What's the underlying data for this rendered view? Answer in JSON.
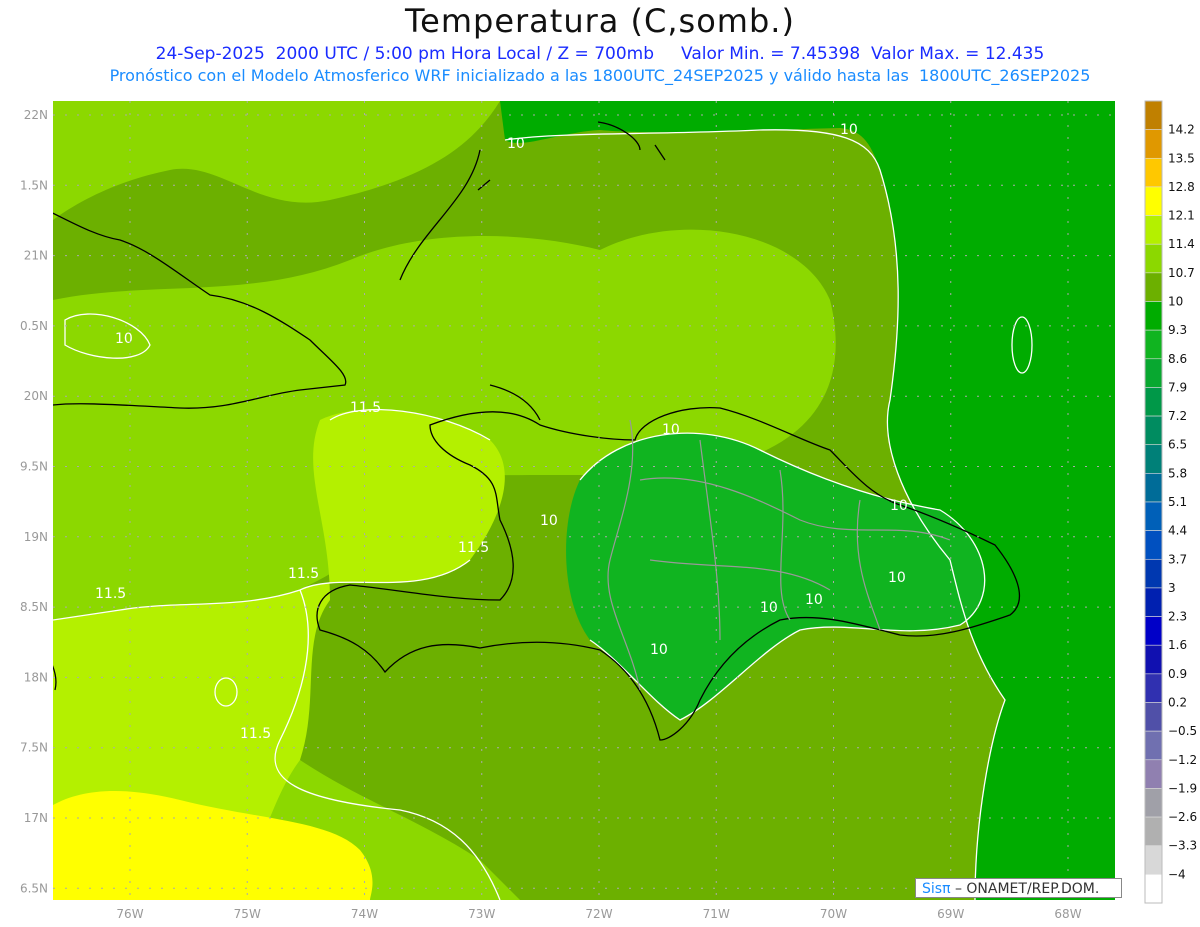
{
  "title": "Temperatura (C,somb.)",
  "subtitle_line1": "24-Sep-2025  2000 UTC / 5:00 pm Hora Local / Z = 700mb     Valor Min. = 7.45398  Valor Max. = 12.435",
  "subtitle_line2": "Pronóstico con el Modelo Atmosferico WRF inicializado a las 1800UTC_24SEP2025 y válido hasta las  1800UTC_26SEP2025",
  "map": {
    "lon_labels": [
      "76W",
      "75W",
      "74W",
      "73W",
      "72W",
      "71W",
      "70W",
      "69W",
      "68W"
    ],
    "lat_labels": [
      "22N",
      "1.5N",
      "21N",
      "0.5N",
      "20N",
      "9.5N",
      "19N",
      "8.5N",
      "18N",
      "7.5N",
      "17N",
      "6.5N"
    ],
    "contour_labels": [
      {
        "text": "10"
      },
      {
        "text": "10"
      },
      {
        "text": "10"
      },
      {
        "text": "10"
      },
      {
        "text": "10"
      },
      {
        "text": "10"
      },
      {
        "text": "10"
      },
      {
        "text": "10"
      },
      {
        "text": "10"
      },
      {
        "text": "10"
      },
      {
        "text": "11.5"
      },
      {
        "text": "11.5"
      },
      {
        "text": "11.5"
      },
      {
        "text": "11.5"
      },
      {
        "text": "11.5"
      }
    ],
    "field_colors": {
      "light_green": "#8cd800",
      "olive": "#6cb000",
      "green": "#00ac00",
      "dark_green": "#10b420",
      "yellow_green": "#b4f000",
      "yellow": "#ffff00"
    }
  },
  "colorbar": {
    "labels": [
      "14.2",
      "13.5",
      "12.8",
      "12.1",
      "11.4",
      "10.7",
      "10",
      "9.3",
      "8.6",
      "7.9",
      "7.2",
      "6.5",
      "5.8",
      "5.1",
      "4.4",
      "3.7",
      "3",
      "2.3",
      "1.6",
      "0.9",
      "0.2",
      "−0.5",
      "−1.2",
      "−1.9",
      "−2.6",
      "−3.3",
      "−4"
    ],
    "colors": [
      "#c08000",
      "#e09800",
      "#ffc800",
      "#ffff00",
      "#b4f000",
      "#8cd800",
      "#6cb000",
      "#00ac00",
      "#10b420",
      "#08a830",
      "#009848",
      "#008c60",
      "#008078",
      "#006c98",
      "#0060b8",
      "#0050c0",
      "#0038b0",
      "#0020b0",
      "#0000c8",
      "#1010b0",
      "#3030b0",
      "#5050a8",
      "#7070b0",
      "#9080b0",
      "#a0a0a8",
      "#b0b0b0",
      "#d8d8d8",
      "#ffffff"
    ]
  },
  "logo": {
    "brand": "Sisπ",
    "text": " – ONAMET/REP.DOM."
  }
}
